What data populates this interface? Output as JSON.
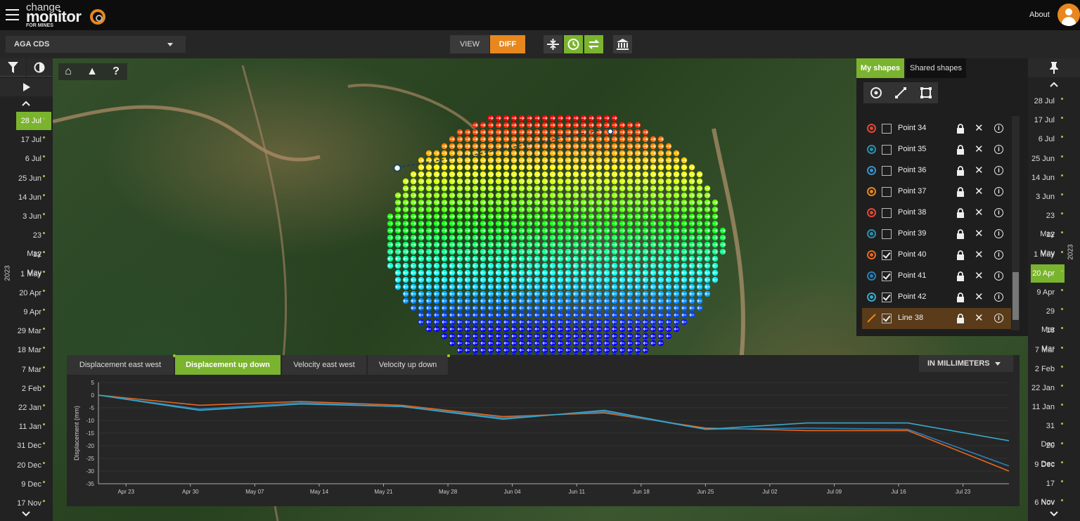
{
  "header": {
    "logo_change": "change",
    "logo_monitor": "monitor",
    "logo_sub": "FOR MINES",
    "about": "About"
  },
  "toolbar": {
    "site": "AGA CDS",
    "view_label": "VIEW",
    "diff_label": "DIFF",
    "accent": "#e8871e",
    "green": "#7ab32e"
  },
  "timeline_left": {
    "year": "2023",
    "dates": [
      "28 Jul",
      "17 Jul",
      "6 Jul",
      "25 Jun",
      "14 Jun",
      "3 Jun",
      "23 May",
      "12 May",
      "1 May",
      "20 Apr",
      "9 Apr",
      "29 Mar",
      "18 Mar",
      "7 Mar",
      "2 Feb",
      "22 Jan",
      "11 Jan",
      "31 Dec",
      "20 Dec",
      "9 Dec",
      "17 Nov"
    ],
    "selected": "28 Jul"
  },
  "timeline_right": {
    "year": "2023",
    "dates": [
      "28 Jul",
      "17 Jul",
      "6 Jul",
      "25 Jun",
      "14 Jun",
      "3 Jun",
      "23 May",
      "12 May",
      "1 May",
      "20 Apr",
      "9 Apr",
      "29 Mar",
      "18 Mar",
      "7 Mar",
      "2 Feb",
      "22 Jan",
      "11 Jan",
      "31 Dec",
      "20 Dec",
      "9 Dec",
      "17 Nov",
      "6 Nov"
    ],
    "selected": "20 Apr"
  },
  "shapes_panel": {
    "tab_my": "My shapes",
    "tab_shared": "Shared shapes",
    "items": [
      {
        "label": "Point 34",
        "color": "#e0473a",
        "checked": false,
        "kind": "point"
      },
      {
        "label": "Point 35",
        "color": "#2a8fa8",
        "checked": false,
        "kind": "point"
      },
      {
        "label": "Point 36",
        "color": "#3a90c8",
        "checked": false,
        "kind": "point"
      },
      {
        "label": "Point 37",
        "color": "#e8871e",
        "checked": false,
        "kind": "point"
      },
      {
        "label": "Point 38",
        "color": "#e0473a",
        "checked": false,
        "kind": "point"
      },
      {
        "label": "Point 39",
        "color": "#2a8fa8",
        "checked": false,
        "kind": "point"
      },
      {
        "label": "Point 40",
        "color": "#e8671e",
        "checked": true,
        "kind": "point"
      },
      {
        "label": "Point 41",
        "color": "#2a7fb8",
        "checked": true,
        "kind": "point"
      },
      {
        "label": "Point 42",
        "color": "#3aa8c8",
        "checked": true,
        "kind": "point"
      },
      {
        "label": "Line 38",
        "color": "#e8871e",
        "checked": true,
        "kind": "line"
      }
    ]
  },
  "chart_tabs": {
    "tabs": [
      "Displacement east west",
      "Displacement up down",
      "Velocity east west",
      "Velocity up down"
    ],
    "active": "Displacement up down",
    "unit": "IN MILLIMETERS"
  },
  "chart_data": {
    "type": "line",
    "ylabel": "Displacement (mm)",
    "ylim": [
      -35,
      5
    ],
    "yticks": [
      5,
      0,
      -5,
      -10,
      -15,
      -20,
      -25,
      -30,
      -35
    ],
    "xticks": [
      "Apr 23",
      "Apr 30",
      "May 07",
      "May 14",
      "May 21",
      "May 28",
      "Jun 04",
      "Jun 11",
      "Jun 18",
      "Jun 25",
      "Jul 02",
      "Jul 09",
      "Jul 16",
      "Jul 23"
    ],
    "x": [
      "2023-04-20",
      "2023-05-01",
      "2023-05-12",
      "2023-05-23",
      "2023-06-03",
      "2023-06-14",
      "2023-06-25",
      "2023-07-06",
      "2023-07-17",
      "2023-07-28"
    ],
    "series": [
      {
        "color": "#e8671e",
        "values": [
          0,
          -4,
          -2.5,
          -4,
          -8.5,
          -7,
          -13,
          -14,
          -14,
          -30
        ]
      },
      {
        "color": "#2a7fb8",
        "values": [
          0,
          -5.5,
          -3,
          -4.5,
          -9,
          -6.5,
          -13.5,
          -13,
          -13.5,
          -28
        ]
      },
      {
        "color": "#3aa8c8",
        "values": [
          0,
          -6,
          -3.5,
          -4.5,
          -9.5,
          -6,
          -13.5,
          -11,
          -11,
          -18
        ]
      }
    ]
  }
}
